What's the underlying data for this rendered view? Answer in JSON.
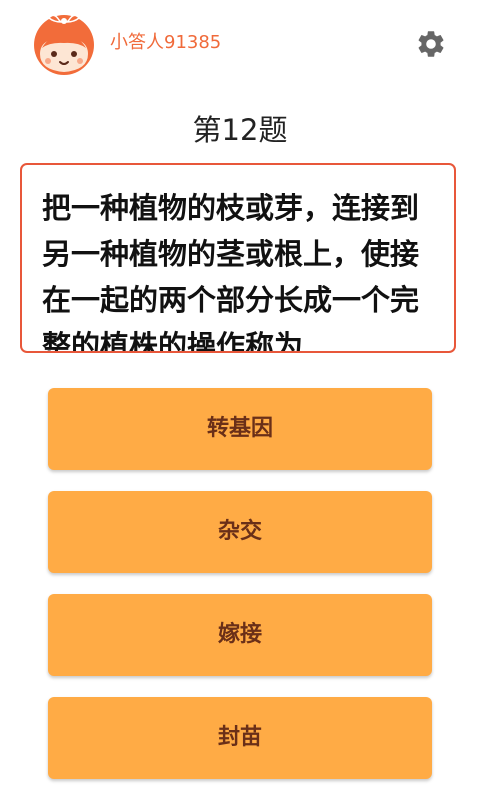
{
  "header": {
    "username": "小答人91385",
    "avatar_icon": "mascot-avatar-icon",
    "settings_icon": "gear-icon"
  },
  "question": {
    "number_label": "第12题",
    "text": "把一种植物的枝或芽，连接到另一种植物的茎或根上，使接在一起的两个部分长成一个完整的植株的操作称为"
  },
  "options": [
    {
      "label": "转基因"
    },
    {
      "label": "杂交"
    },
    {
      "label": "嫁接"
    },
    {
      "label": "封苗"
    }
  ],
  "colors": {
    "accent": "#f06a3a",
    "question_border": "#e8573a",
    "option_bg": "#ffab45",
    "option_text": "#6a2f18",
    "icon_gray": "#666666"
  }
}
